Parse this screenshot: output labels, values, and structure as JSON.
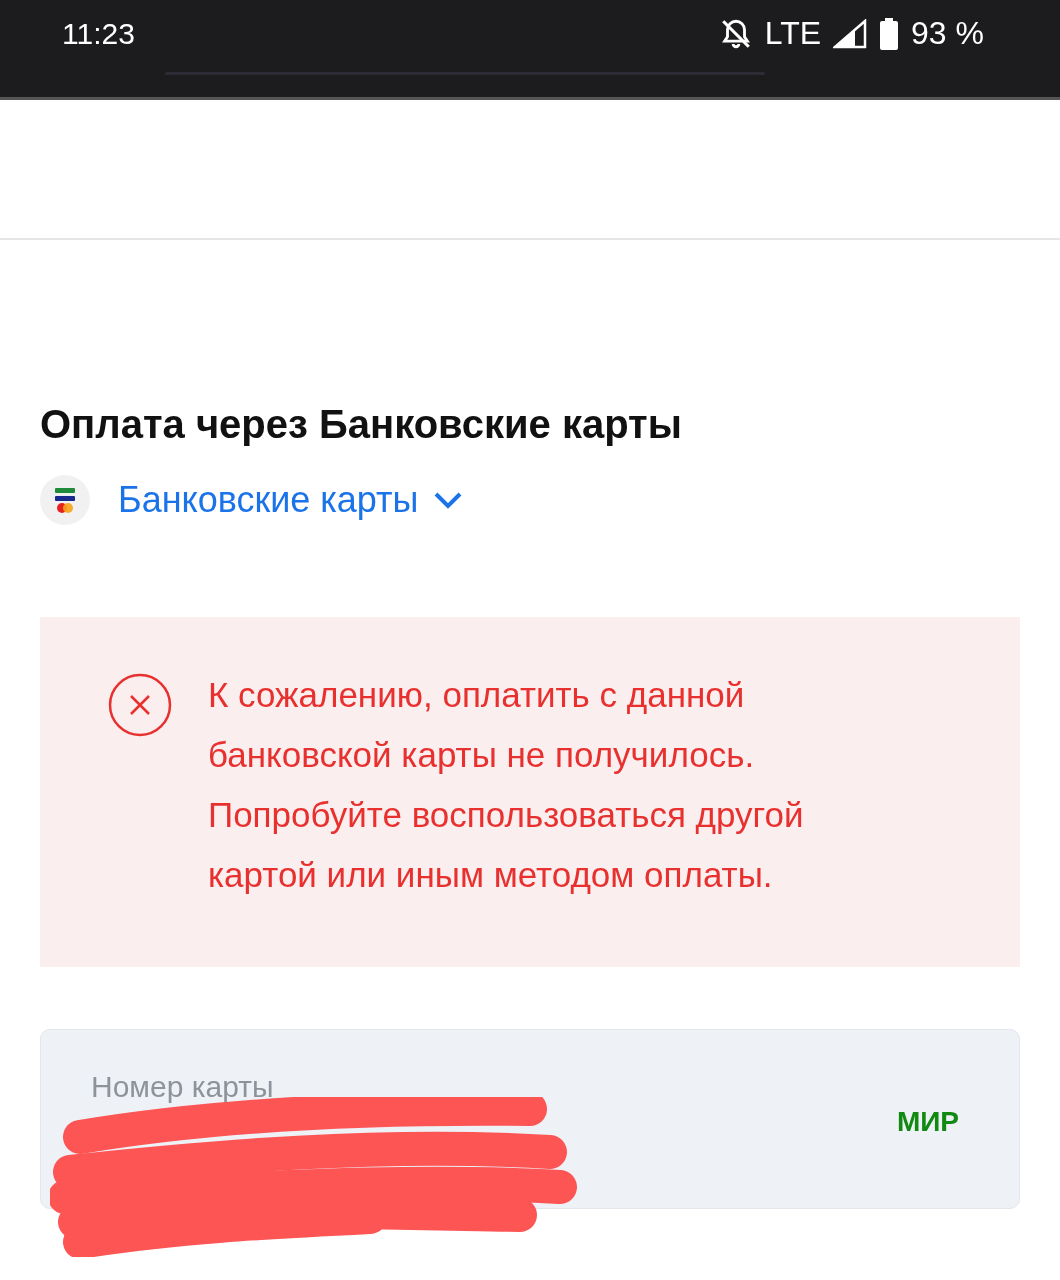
{
  "status_bar": {
    "time": "11:23",
    "network": "LTE",
    "battery": "93 %"
  },
  "section_title": "Оплата через Банковские карты",
  "method_selector": {
    "label": "Банковские карты"
  },
  "error": {
    "message": "К сожалению, оплатить с данной банковской карты не получилось. Попробуйте воспользоваться другой картой или иным методом оплаты."
  },
  "card_field": {
    "label": "Номер карты",
    "brand": "МИР"
  }
}
